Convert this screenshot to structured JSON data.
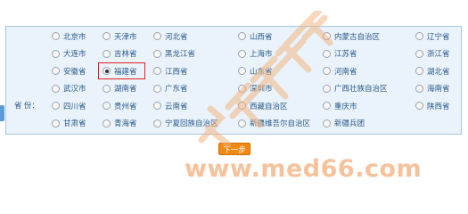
{
  "form": {
    "row_label": "省  份：",
    "selected_value": "福建省",
    "provinces": [
      {
        "label": "北京市",
        "checked": false
      },
      {
        "label": "天津市",
        "checked": false
      },
      {
        "label": "河北省",
        "checked": false
      },
      {
        "label": "山西省",
        "checked": false
      },
      {
        "label": "内蒙古自治区",
        "checked": false
      },
      {
        "label": "辽宁省",
        "checked": false
      },
      {
        "label": "大连市",
        "checked": false
      },
      {
        "label": "吉林省",
        "checked": false
      },
      {
        "label": "黑龙江省",
        "checked": false
      },
      {
        "label": "上海市",
        "checked": false
      },
      {
        "label": "江苏省",
        "checked": false
      },
      {
        "label": "浙江省",
        "checked": false
      },
      {
        "label": "安徽省",
        "checked": false
      },
      {
        "label": "福建省",
        "checked": true
      },
      {
        "label": "江西省",
        "checked": false
      },
      {
        "label": "山东省",
        "checked": false
      },
      {
        "label": "河南省",
        "checked": false
      },
      {
        "label": "湖北省",
        "checked": false
      },
      {
        "label": "武汉市",
        "checked": false
      },
      {
        "label": "湖南省",
        "checked": false
      },
      {
        "label": "广东省",
        "checked": false
      },
      {
        "label": "深圳市",
        "checked": false
      },
      {
        "label": "广西壮族自治区",
        "checked": false
      },
      {
        "label": "海南省",
        "checked": false
      },
      {
        "label": "四川省",
        "checked": false
      },
      {
        "label": "贵州省",
        "checked": false
      },
      {
        "label": "云南省",
        "checked": false
      },
      {
        "label": "西藏自治区",
        "checked": false
      },
      {
        "label": "重庆市",
        "checked": false
      },
      {
        "label": "陕西省",
        "checked": false
      },
      {
        "label": "甘肃省",
        "checked": false
      },
      {
        "label": "青海省",
        "checked": false
      },
      {
        "label": "宁夏回族自治区",
        "checked": false
      },
      {
        "label": "新疆维吾尔自治区",
        "checked": false
      },
      {
        "label": "新疆兵团",
        "checked": false
      }
    ],
    "next_button": "下一步"
  },
  "watermark": {
    "brand_text": "医学教育网",
    "url_text": "www.med66.com"
  },
  "colors": {
    "panel_bg": "#eaf3fb",
    "panel_border": "#a9c6e1",
    "label_text": "#2b5a8a",
    "button_bg": "#f08a14",
    "highlight": "#e02020",
    "watermark": "#f5b88a"
  }
}
